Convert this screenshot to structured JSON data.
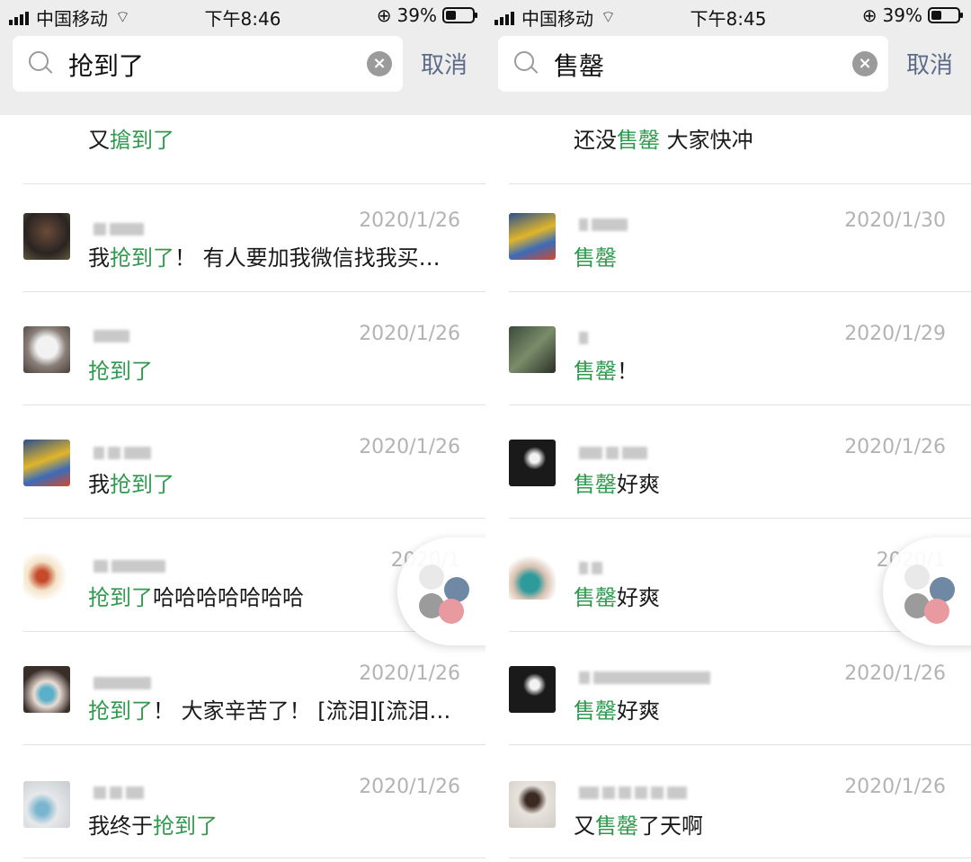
{
  "screens": [
    {
      "status": {
        "carrier": "中国移动",
        "time": "下午8:46",
        "battery": "39%"
      },
      "search": {
        "query": "抢到了",
        "cancel": "取消"
      },
      "results": [
        {
          "date": "",
          "pre": "又",
          "hl": "搶到了",
          "post": ""
        },
        {
          "date": "2020/1/26",
          "pre": "我",
          "hl": "抢到了",
          "post": "！ 有人要加我微信找我买…"
        },
        {
          "date": "2020/1/26",
          "pre": "",
          "hl": "抢到了",
          "post": ""
        },
        {
          "date": "2020/1/26",
          "pre": "我",
          "hl": "抢到了",
          "post": ""
        },
        {
          "date": "2020/1",
          "pre": "",
          "hl": "抢到了",
          "post": "哈哈哈哈哈哈哈"
        },
        {
          "date": "2020/1/26",
          "pre": "",
          "hl": "抢到了",
          "post": "！ 大家辛苦了！ [流泪][流泪…"
        },
        {
          "date": "2020/1/26",
          "pre": "我终于",
          "hl": "抢到了",
          "post": ""
        }
      ]
    },
    {
      "status": {
        "carrier": "中国移动",
        "time": "下午8:45",
        "battery": "39%"
      },
      "search": {
        "query": "售罄",
        "cancel": "取消"
      },
      "results": [
        {
          "date": "",
          "pre": "还没",
          "hl": "售罄",
          "post": " 大家快冲"
        },
        {
          "date": "2020/1/30",
          "pre": "",
          "hl": "售罄",
          "post": ""
        },
        {
          "date": "2020/1/29",
          "pre": "",
          "hl": "售罄",
          "post": "！"
        },
        {
          "date": "2020/1/26",
          "pre": "",
          "hl": "售罄",
          "post": "好爽"
        },
        {
          "date": "2020/1",
          "pre": "",
          "hl": "售罄",
          "post": "好爽"
        },
        {
          "date": "2020/1/26",
          "pre": "",
          "hl": "售罄",
          "post": "好爽"
        },
        {
          "date": "2020/1/26",
          "pre": "又",
          "hl": "售罄",
          "post": "了天啊"
        }
      ]
    }
  ],
  "colors": {
    "highlight": "#2f9a4e",
    "cancel": "#5d6c87",
    "date": "#b3b3b3"
  },
  "icons": [
    "signal-icon",
    "wifi-icon",
    "lock-rotation-icon",
    "battery-icon",
    "search-icon",
    "clear-icon",
    "floating-multitask-icon"
  ]
}
